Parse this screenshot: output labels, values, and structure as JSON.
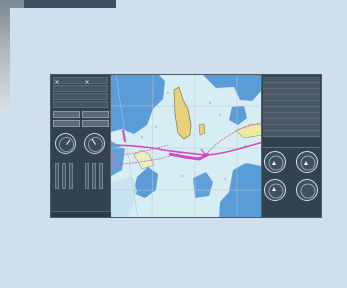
{
  "screen": {
    "left_panel": {
      "top_rows": [
        "",
        "",
        "",
        ""
      ],
      "buttons": [
        "",
        "",
        "",
        ""
      ],
      "footer_labels": [
        "",
        "",
        ""
      ]
    },
    "right_panel": {
      "rows": [
        "",
        "",
        "",
        "",
        "",
        "",
        "",
        "",
        "",
        ""
      ],
      "status_tiles": [
        "",
        "",
        ""
      ]
    }
  },
  "colors": {
    "background": "#cfdfee",
    "screen": "#2a3946",
    "chart_water": "#d7edf4",
    "route": "#d14bc5",
    "land": "#e7d27a",
    "shoal": "#4c92d4"
  },
  "icons": [
    "close-icon",
    "close-icon",
    "compass-icon",
    "compass-icon",
    "triangle-icon",
    "triangle-icon",
    "triangle-icon"
  ]
}
